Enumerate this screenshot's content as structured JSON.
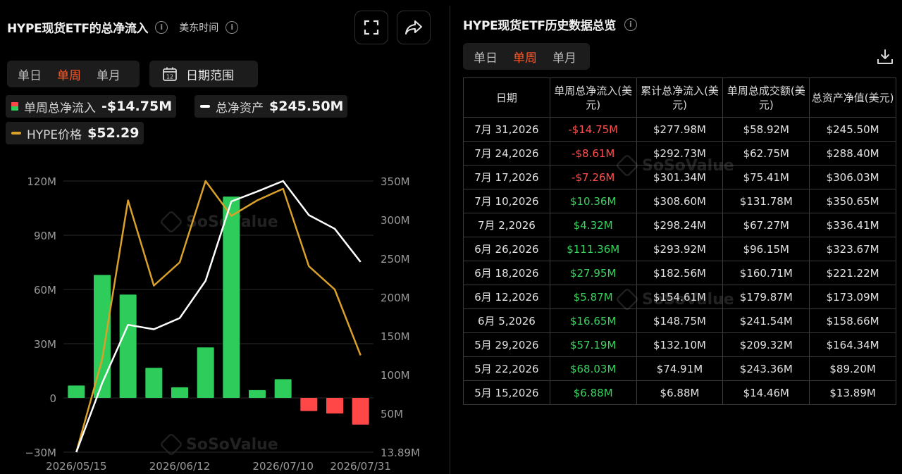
{
  "left": {
    "title": "HYPE现货ETF的总净流入",
    "timezone": "美东时间",
    "period_tabs": [
      "单日",
      "单周",
      "单月"
    ],
    "active_period": "单周",
    "date_range_label": "日期范围",
    "date_range_icon_text": "12",
    "legend": {
      "flow_label": "单周总净流入",
      "flow_value": "-$14.75M",
      "assets_label": "总净资产",
      "assets_value": "$245.50M",
      "price_label": "HYPE价格",
      "price_value": "$52.29"
    },
    "watermark": "SoSoValue",
    "watermark_url": "sosovalue.com"
  },
  "right": {
    "title": "HYPE现货ETF历史数据总览",
    "period_tabs": [
      "单日",
      "单周",
      "单月"
    ],
    "active_period": "单周",
    "headers": [
      "日期",
      "单周总净流入(美元)",
      "累计总净流入(美元)",
      "单周总成交额(美元)",
      "总资产净值(美元)"
    ],
    "rows": [
      [
        "7月 31,2026",
        "-$14.75M",
        "$277.98M",
        "$58.92M",
        "$245.50M"
      ],
      [
        "7月 24,2026",
        "-$8.61M",
        "$292.73M",
        "$62.75M",
        "$288.40M"
      ],
      [
        "7月 17,2026",
        "-$7.26M",
        "$301.34M",
        "$75.41M",
        "$306.03M"
      ],
      [
        "7月 10,2026",
        "$10.36M",
        "$308.60M",
        "$131.78M",
        "$350.65M"
      ],
      [
        "7月 2,2026",
        "$4.32M",
        "$298.24M",
        "$67.27M",
        "$336.41M"
      ],
      [
        "6月 26,2026",
        "$111.36M",
        "$293.92M",
        "$96.15M",
        "$323.67M"
      ],
      [
        "6月 18,2026",
        "$27.95M",
        "$182.56M",
        "$160.71M",
        "$221.22M"
      ],
      [
        "6月 12,2026",
        "$5.87M",
        "$154.61M",
        "$179.87M",
        "$173.09M"
      ],
      [
        "6月 5,2026",
        "$16.65M",
        "$148.75M",
        "$241.54M",
        "$158.66M"
      ],
      [
        "5月 29,2026",
        "$57.19M",
        "$132.10M",
        "$209.32M",
        "$164.34M"
      ],
      [
        "5月 22,2026",
        "$68.03M",
        "$74.91M",
        "$243.36M",
        "$89.20M"
      ],
      [
        "5月 15,2026",
        "$6.88M",
        "$6.88M",
        "$14.46M",
        "$13.89M"
      ]
    ]
  },
  "colors": {
    "positive": "#2ecc5a",
    "negative": "#ff4747",
    "assets_line": "#ffffff",
    "price_line": "#d9a12a",
    "active_tab": "#ff5a2a"
  },
  "chart_data": {
    "type": "bar",
    "x": [
      "2026/05/15",
      "2026/05/22",
      "2026/05/29",
      "2026/06/05",
      "2026/06/12",
      "2026/06/18",
      "2026/06/26",
      "2026/07/02",
      "2026/07/10",
      "2026/07/17",
      "2026/07/24",
      "2026/07/31"
    ],
    "x_tick_labels": [
      "2026/05/15",
      "2026/06/12",
      "2026/07/10",
      "2026/07/31"
    ],
    "x_tick_indices": [
      0,
      4,
      8,
      11
    ],
    "left_axis": {
      "ticks": [
        "120M",
        "90M",
        "60M",
        "30M",
        "0",
        "−30M"
      ],
      "values": [
        120,
        90,
        60,
        30,
        0,
        -30
      ],
      "ylim": [
        -30,
        120
      ]
    },
    "right_axis": {
      "ticks": [
        "350M",
        "300M",
        "250M",
        "200M",
        "150M",
        "100M",
        "50M",
        "13.89M"
      ],
      "values": [
        350,
        300,
        250,
        200,
        150,
        100,
        50,
        13.89
      ],
      "ylim": [
        13.89,
        350
      ]
    },
    "series": [
      {
        "name": "单周总净流入",
        "kind": "bar",
        "axis": "left",
        "values": [
          6.88,
          68.03,
          57.19,
          16.65,
          5.87,
          27.95,
          111.36,
          4.32,
          10.36,
          -7.26,
          -8.61,
          -14.75
        ]
      },
      {
        "name": "总净资产",
        "kind": "line",
        "axis": "right",
        "values": [
          13.89,
          89.2,
          164.34,
          158.66,
          173.09,
          221.22,
          323.67,
          336.41,
          350.65,
          306.03,
          288.4,
          245.5
        ]
      },
      {
        "name": "HYPE价格",
        "kind": "line",
        "axis": "right",
        "values": [
          13.89,
          120,
          325,
          215,
          245,
          350,
          305,
          325,
          340,
          240,
          210,
          125
        ]
      }
    ],
    "grid": "horizontal",
    "legend_position": "top-left"
  }
}
